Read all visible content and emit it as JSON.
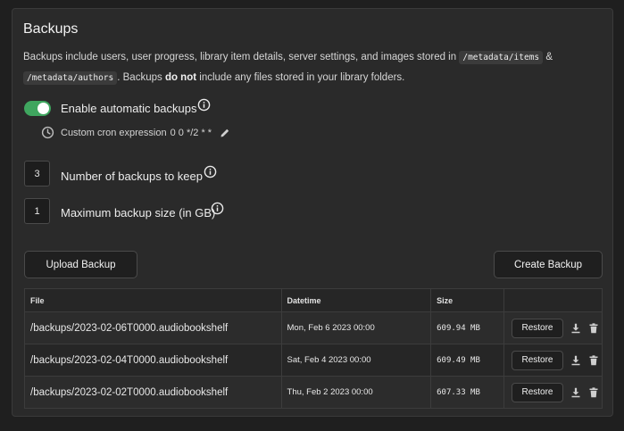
{
  "section": {
    "title": "Backups",
    "desc_part1": "Backups include users, user progress, library item details, server settings, and images stored in",
    "code_items": "/metadata/items",
    "amp": "&",
    "code_authors": "/metadata/authors",
    "desc_part2": ". Backups",
    "desc_bold": "do not",
    "desc_part3": "include any files stored in your library folders."
  },
  "settings": {
    "auto_backup_label": "Enable automatic backups",
    "auto_backup_enabled": true,
    "cron_label": "Custom cron expression",
    "cron_value": "0 0 */2 * *",
    "keep_value": "3",
    "keep_label": "Number of backups to keep",
    "max_size_value": "1",
    "max_size_label": "Maximum backup size (in GB)"
  },
  "buttons": {
    "upload": "Upload Backup",
    "create": "Create Backup"
  },
  "table": {
    "headers": {
      "file": "File",
      "datetime": "Datetime",
      "size": "Size"
    },
    "restore_label": "Restore",
    "rows": [
      {
        "file": "/backups/2023-02-06T0000.audiobookshelf",
        "datetime": "Mon, Feb 6 2023 00:00",
        "size": "609.94 MB"
      },
      {
        "file": "/backups/2023-02-04T0000.audiobookshelf",
        "datetime": "Sat, Feb 4 2023 00:00",
        "size": "609.49 MB"
      },
      {
        "file": "/backups/2023-02-02T0000.audiobookshelf",
        "datetime": "Thu, Feb 2 2023 00:00",
        "size": "607.33 MB"
      }
    ]
  },
  "colors": {
    "toggle_on": "#3fa65f",
    "background": "#1f1f1f",
    "panel": "#2a2a2a"
  },
  "icons": [
    "info-icon",
    "clock-icon",
    "pencil-icon",
    "download-icon",
    "trash-icon"
  ]
}
